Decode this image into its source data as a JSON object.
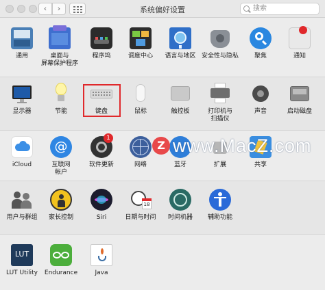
{
  "window": {
    "title": "系统偏好设置",
    "search_placeholder": "搜索"
  },
  "colors": {
    "highlight_border": "#e0282b",
    "watermark_logo": "#e8494a"
  },
  "watermark": {
    "text": "www.MacZ.com",
    "logo_letter": "Z"
  },
  "rows": [
    [
      {
        "label": "通用",
        "icon": "general-icon"
      },
      {
        "label": "桌面与\n屏幕保护程序",
        "icon": "desktop-screensaver-icon"
      },
      {
        "label": "程序坞",
        "icon": "dock-icon"
      },
      {
        "label": "调度中心",
        "icon": "mission-control-icon"
      },
      {
        "label": "语言与地区",
        "icon": "language-region-icon"
      },
      {
        "label": "安全性与隐私",
        "icon": "security-privacy-icon"
      },
      {
        "label": "聚焦",
        "icon": "spotlight-icon"
      },
      {
        "label": "通知",
        "icon": "notifications-icon"
      }
    ],
    [
      {
        "label": "显示器",
        "icon": "displays-icon"
      },
      {
        "label": "节能",
        "icon": "energy-saver-icon"
      },
      {
        "label": "键盘",
        "icon": "keyboard-icon"
      },
      {
        "label": "鼠标",
        "icon": "mouse-icon"
      },
      {
        "label": "触控板",
        "icon": "trackpad-icon"
      },
      {
        "label": "打印机与\n扫描仪",
        "icon": "printers-scanners-icon"
      },
      {
        "label": "声音",
        "icon": "sound-icon"
      },
      {
        "label": "启动磁盘",
        "icon": "startup-disk-icon"
      }
    ],
    [
      {
        "label": "iCloud",
        "icon": "icloud-icon"
      },
      {
        "label": "互联网\n帐户",
        "icon": "internet-accounts-icon"
      },
      {
        "label": "软件更新",
        "icon": "software-update-icon",
        "badge": "1"
      },
      {
        "label": "网络",
        "icon": "network-icon"
      },
      {
        "label": "蓝牙",
        "icon": "bluetooth-icon"
      },
      {
        "label": "扩展",
        "icon": "extensions-icon"
      },
      {
        "label": "共享",
        "icon": "sharing-icon"
      }
    ],
    [
      {
        "label": "用户与群组",
        "icon": "users-groups-icon"
      },
      {
        "label": "家长控制",
        "icon": "parental-controls-icon"
      },
      {
        "label": "Siri",
        "icon": "siri-icon"
      },
      {
        "label": "日期与时间",
        "icon": "date-time-icon",
        "calendar_day": "18"
      },
      {
        "label": "时间机器",
        "icon": "time-machine-icon"
      },
      {
        "label": "辅助功能",
        "icon": "accessibility-icon"
      }
    ],
    [
      {
        "label": "LUT Utility",
        "icon": "lut-utility-icon",
        "icon_text": "LUT"
      },
      {
        "label": "Endurance",
        "icon": "endurance-icon"
      },
      {
        "label": "Java",
        "icon": "java-icon"
      }
    ]
  ]
}
